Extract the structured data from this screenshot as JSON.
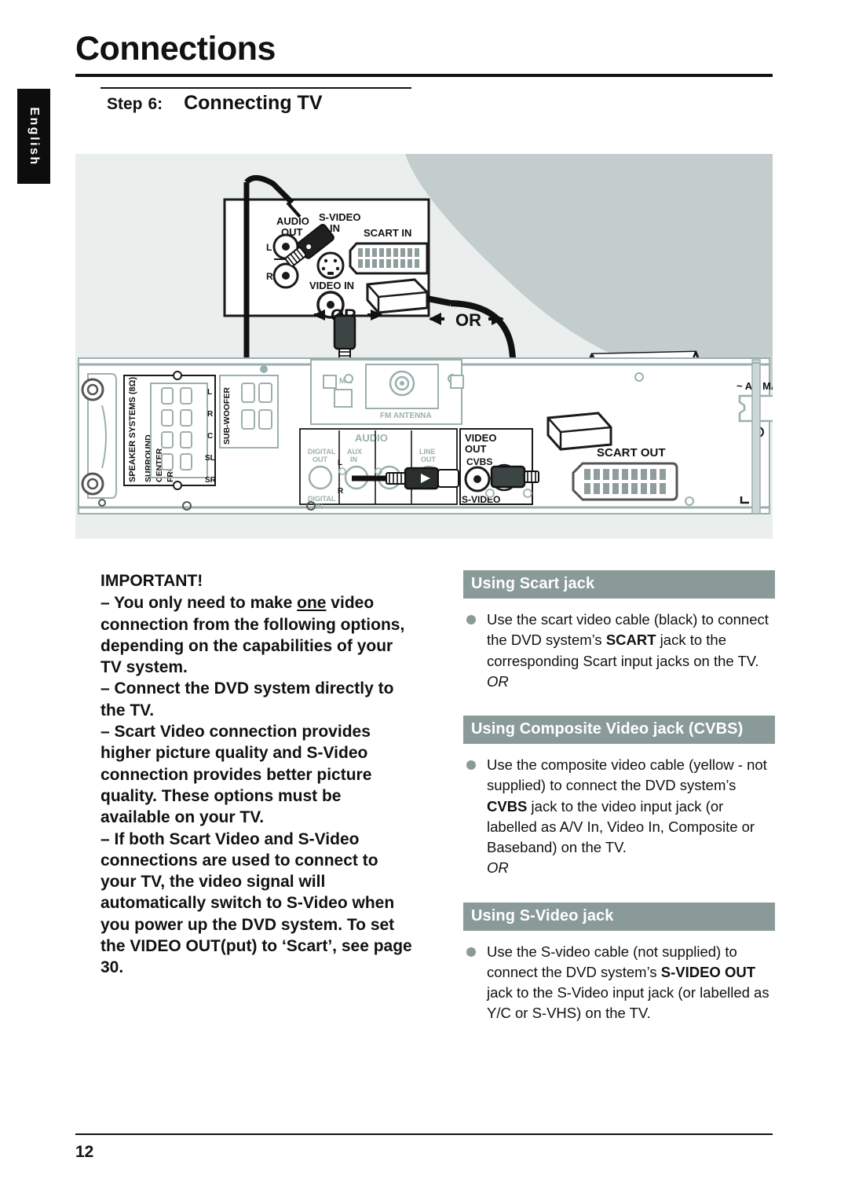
{
  "language_tab": {
    "label": "English"
  },
  "header": {
    "title": "Connections",
    "step_word": "Step",
    "step_number": "6:",
    "step_name": "Connecting TV"
  },
  "diagram": {
    "tv_panel": {
      "audio_out": "AUDIO",
      "audio_out_2": "OUT",
      "left": "L",
      "right": "R",
      "svideo_in": "S-VIDEO",
      "svideo_in_2": "IN",
      "video_in": "VIDEO IN",
      "scart_in": "SCART IN"
    },
    "or_labels": [
      "OR",
      "OR"
    ],
    "dvd_panel": {
      "speaker_systems": "SPEAKER SYSTEMS (8Ω)",
      "surround": "SURROUND",
      "center": "CENTER",
      "front": "FRONT",
      "channels": [
        "L",
        "R",
        "C",
        "SL",
        "SR"
      ],
      "subwoofer": "SUB-WOOFER",
      "digital_out": "DIGITAL",
      "digital_out_2": "OUT",
      "digital_in": "DIGITAL",
      "digital_in_2": "IN",
      "aux_in": "AUX",
      "aux_in_2": "IN",
      "line_out": "LINE",
      "line_out_2": "OUT",
      "audio": "AUDIO",
      "audio_l": "L",
      "audio_r": "R",
      "mw": "MW",
      "fm_antenna": "FM ANTENNA",
      "video_out": "VIDEO",
      "video_out_2": "OUT",
      "cvbs": "CVBS",
      "svideo": "S-VIDEO",
      "scart_out": "SCART OUT",
      "ac_mains": "~ AC MAINS"
    }
  },
  "important": {
    "heading": "IMPORTANT!",
    "paragraphs": [
      {
        "pre": "–  You only need to make ",
        "underlined": "one",
        "post": " video connection from the following options, depending on the capabilities of your TV system."
      },
      {
        "pre": "–  Connect the DVD system directly to the TV.",
        "underlined": "",
        "post": ""
      },
      {
        "pre": "–  Scart Video connection provides higher picture quality and S-Video connection provides better picture quality. These options must be available on your TV.",
        "underlined": "",
        "post": ""
      },
      {
        "pre": "–   If both Scart Video and S-Video connections are used to connect to your TV, the video signal will automatically switch to S-Video when you power up the DVD system. To set the VIDEO OUT(put) to ‘Scart’, see page 30.",
        "underlined": "",
        "post": ""
      }
    ]
  },
  "sections": [
    {
      "heading": "Using Scart jack",
      "body_1": "Use the scart video cable (black) to connect the DVD system’s ",
      "emphasis_1": "SCART",
      "body_2": " jack to the corresponding Scart input jacks on the TV.",
      "or": "OR"
    },
    {
      "heading": "Using Composite Video jack (CVBS)",
      "body_1": "Use the composite video cable (yellow - not supplied) to connect the DVD system’s ",
      "emphasis_1": "CVBS",
      "body_2": " jack to the video input jack (or labelled as A/V In, Video In, Composite or Baseband) on the TV.",
      "or": "OR"
    },
    {
      "heading": "Using S-Video jack",
      "body_1": "Use the S-video cable (not supplied) to connect the DVD system’s ",
      "emphasis_1": "S-VIDEO OUT",
      "body_2": " jack to the S-Video input jack (or labelled as Y/C or S-VHS) on the TV.",
      "or": ""
    }
  ],
  "footer": {
    "page_number": "12"
  },
  "colors": {
    "diagram_background": "#eaeeed",
    "section_header": "#8a9a99",
    "bullet": "#8a9a99",
    "tab_background": "#0d0d0d",
    "shadow_grey": "#b6c2c1",
    "panel_line_grey": "#9bb0ae"
  }
}
